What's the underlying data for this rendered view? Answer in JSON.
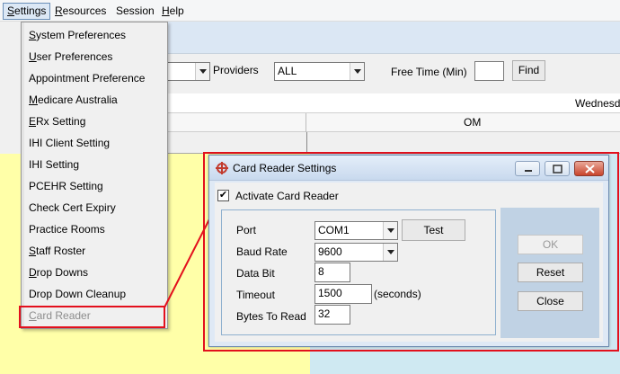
{
  "menubar": {
    "items": [
      {
        "label": "Settings",
        "accel": "S",
        "rest": "ettings"
      },
      {
        "label": "Resources",
        "accel": "R",
        "rest": "esources"
      },
      {
        "label": "Session",
        "accel": "",
        "rest": "Session"
      },
      {
        "label": "Help",
        "accel": "H",
        "rest": "elp"
      }
    ]
  },
  "settings_menu": {
    "items": [
      {
        "label": "System Preferences",
        "accel": "S",
        "rest": "ystem Preferences",
        "enabled": true
      },
      {
        "label": "User Preferences",
        "accel": "U",
        "rest": "ser Preferences",
        "enabled": true
      },
      {
        "label": "Appointment Preference",
        "accel": "",
        "rest": "Appointment Preference",
        "enabled": true
      },
      {
        "label": "Medicare Australia",
        "accel": "M",
        "rest": "edicare Australia",
        "enabled": true
      },
      {
        "label": "ERx Setting",
        "accel": "E",
        "rest": "Rx Setting",
        "enabled": true
      },
      {
        "label": "IHI Client Setting",
        "accel": "",
        "rest": "IHI Client Setting",
        "enabled": true
      },
      {
        "label": "IHI Setting",
        "accel": "",
        "rest": "IHI Setting",
        "enabled": true
      },
      {
        "label": "PCEHR Setting",
        "accel": "",
        "rest": "PCEHR Setting",
        "enabled": true
      },
      {
        "label": "Check Cert Expiry",
        "accel": "",
        "rest": "Check Cert Expiry",
        "enabled": true
      },
      {
        "label": "Practice Rooms",
        "accel": "",
        "rest": "Practice Rooms",
        "enabled": true
      },
      {
        "label": "Staff Roster",
        "accel": "S",
        "rest": "taff Roster",
        "enabled": true
      },
      {
        "label": "Drop Downs",
        "accel": "D",
        "rest": "rop Downs",
        "enabled": true
      },
      {
        "label": "Drop Down Cleanup",
        "accel": "",
        "rest": "Drop Down Cleanup",
        "enabled": true
      },
      {
        "label": "Card Reader",
        "accel": "C",
        "rest": "ard Reader",
        "enabled": false
      }
    ]
  },
  "filter": {
    "providers_label": "Providers",
    "providers_value": "ALL",
    "free_time_label": "Free Time (Min)",
    "free_time_value": "",
    "find_label": "Find"
  },
  "calendar": {
    "day_header": "Wednesd",
    "period_header": "OM"
  },
  "dialog": {
    "title": "Card Reader Settings",
    "activate_label": "Activate Card Reader",
    "activate_checked": "✔",
    "port_label": {
      "accel": "",
      "text": "Port"
    },
    "port_value": "COM1",
    "test_label": "Test",
    "baud_label": "Baud Rate",
    "baud_value": "9600",
    "databit_label": "Data Bit",
    "databit_value": "8",
    "timeout_label": "Timeout",
    "timeout_value": "1500",
    "timeout_unit": "(seconds)",
    "bytes_label": "Bytes To Read",
    "bytes_value": "32",
    "ok_label": "OK",
    "reset_label": "Reset",
    "close_label": "Close"
  },
  "colors": {
    "highlight_red": "#e3101d",
    "schedule_yellow": "#ffffa8",
    "dialog_frame": "#dfe9f5"
  }
}
